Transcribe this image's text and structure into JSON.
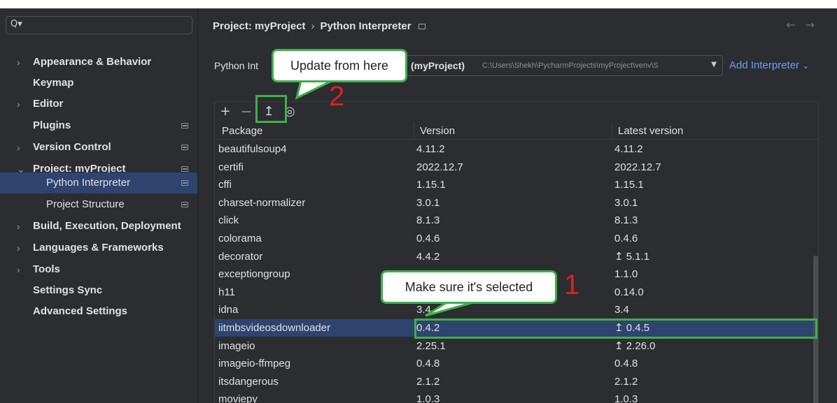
{
  "sidebar": {
    "search_icon": "search-icon",
    "items": [
      {
        "label": "Appearance & Behavior",
        "expandable": true
      },
      {
        "label": "Keymap",
        "expandable": false
      },
      {
        "label": "Editor",
        "expandable": true
      },
      {
        "label": "Plugins",
        "expandable": false
      },
      {
        "label": "Version Control",
        "expandable": true
      },
      {
        "label": "Project: myProject",
        "expandable": true,
        "expanded": true
      },
      {
        "label": "Python Interpreter",
        "sub": true,
        "selected": true
      },
      {
        "label": "Project Structure",
        "sub": true
      },
      {
        "label": "Build, Execution, Deployment",
        "expandable": true
      },
      {
        "label": "Languages & Frameworks",
        "expandable": true
      },
      {
        "label": "Tools",
        "expandable": true
      },
      {
        "label": "Settings Sync",
        "expandable": false
      },
      {
        "label": "Advanced Settings",
        "expandable": false
      }
    ]
  },
  "header": {
    "crumb1": "Project: myProject",
    "separator": "›",
    "crumb2": "Python Interpreter",
    "back": "←",
    "forward": "→"
  },
  "interpreter": {
    "label": "Python Int",
    "value_bold": "(myProject)",
    "path": "C:\\Users\\Shekh\\PycharmProjects\\myProject\\venv\\S",
    "add_label": "Add Interpreter"
  },
  "toolbar": {
    "add": "+",
    "remove": "—",
    "upgrade": "↥",
    "show": "◎"
  },
  "table": {
    "columns": [
      "Package",
      "Version",
      "Latest version"
    ],
    "rows": [
      {
        "package": "beautifulsoup4",
        "version": "4.11.2",
        "latest": "4.11.2"
      },
      {
        "package": "certifi",
        "version": "2022.12.7",
        "latest": "2022.12.7"
      },
      {
        "package": "cffi",
        "version": "1.15.1",
        "latest": "1.15.1"
      },
      {
        "package": "charset-normalizer",
        "version": "3.0.1",
        "latest": "3.0.1"
      },
      {
        "package": "click",
        "version": "8.1.3",
        "latest": "8.1.3"
      },
      {
        "package": "colorama",
        "version": "0.4.6",
        "latest": "0.4.6"
      },
      {
        "package": "decorator",
        "version": "4.4.2",
        "latest": "↥ 5.1.1"
      },
      {
        "package": "exceptiongroup",
        "version": "",
        "latest": "1.1.0"
      },
      {
        "package": "h11",
        "version": "",
        "latest": "0.14.0"
      },
      {
        "package": "idna",
        "version": "3.4",
        "latest": "3.4"
      },
      {
        "package": "iitmbsvideosdownloader",
        "version": "0.4.2",
        "latest": "↥ 0.4.5",
        "selected": true
      },
      {
        "package": "imageio",
        "version": "2.25.1",
        "latest": "↥ 2.26.0"
      },
      {
        "package": "imageio-ffmpeg",
        "version": "0.4.8",
        "latest": "0.4.8"
      },
      {
        "package": "itsdangerous",
        "version": "2.1.2",
        "latest": "2.1.2"
      },
      {
        "package": "moviepy",
        "version": "1.0.3",
        "latest": "1.0.3"
      }
    ]
  },
  "annotations": {
    "callout_update": "Update from here",
    "callout_selected": "Make sure it's selected",
    "number_1": "1",
    "number_2": "2",
    "accent_color": "#3fb04b",
    "number_color": "#e0201b"
  }
}
